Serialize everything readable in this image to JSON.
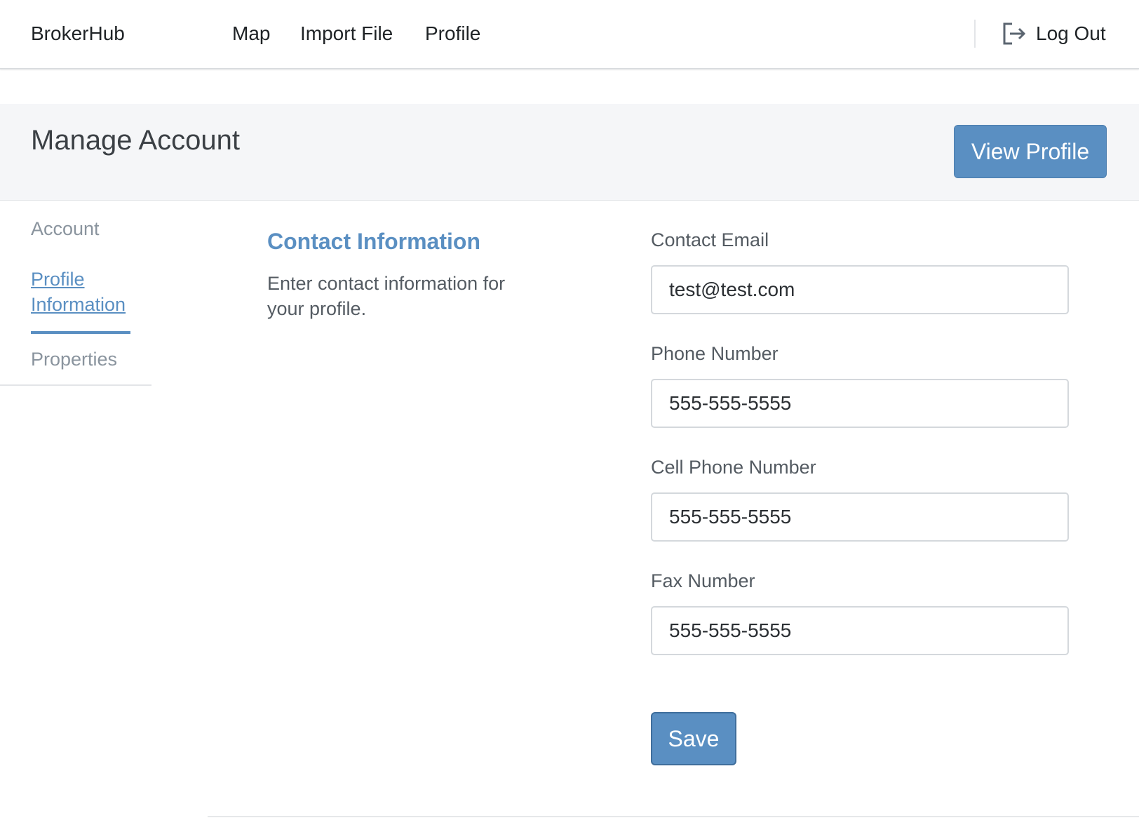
{
  "nav": {
    "brand": "BrokerHub",
    "links": [
      {
        "label": "Map"
      },
      {
        "label": "Import File"
      },
      {
        "label": "Profile"
      }
    ],
    "logout_label": "Log Out",
    "logout_icon": "logout-icon"
  },
  "header": {
    "title": "Manage Account",
    "view_profile_label": "View Profile"
  },
  "sidebar": {
    "items": [
      {
        "label": "Account",
        "active": false
      },
      {
        "label": "Profile Information",
        "active": true
      },
      {
        "label": "Properties",
        "active": false
      }
    ]
  },
  "section": {
    "title": "Contact Information",
    "description": "Enter contact information for your profile."
  },
  "form": {
    "fields": [
      {
        "label": "Contact Email",
        "value": "test@test.com"
      },
      {
        "label": "Phone Number",
        "value": "555-555-5555"
      },
      {
        "label": "Cell Phone Number",
        "value": "555-555-5555"
      },
      {
        "label": "Fax Number",
        "value": "555-555-5555"
      }
    ],
    "save_label": "Save"
  },
  "colors": {
    "accent": "#5a8fc2",
    "header_band": "#f5f6f8"
  }
}
